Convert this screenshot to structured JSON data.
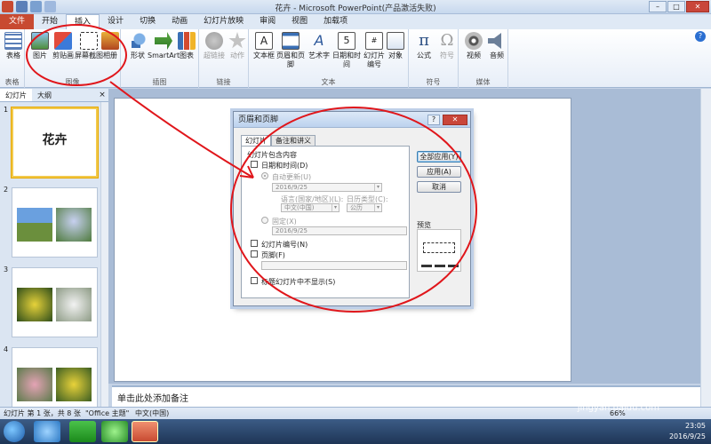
{
  "window": {
    "title": "花卉 - Microsoft PowerPoint(产品激活失败)"
  },
  "tabs": [
    "文件",
    "开始",
    "插入",
    "设计",
    "切换",
    "动画",
    "幻灯片放映",
    "审阅",
    "视图",
    "加载项"
  ],
  "ribbon": {
    "groups": {
      "table": {
        "label": "表格",
        "buttons": [
          "表格"
        ]
      },
      "images": {
        "label": "图像",
        "buttons": [
          "图片",
          "剪贴画",
          "屏幕截图",
          "相册"
        ]
      },
      "illustrations": {
        "label": "插图",
        "buttons": [
          "形状",
          "SmartArt",
          "图表"
        ]
      },
      "links": {
        "label": "链接",
        "buttons": [
          "超链接",
          "动作"
        ]
      },
      "text": {
        "label": "文本",
        "buttons": [
          "文本框",
          "页眉和页脚",
          "艺术字",
          "日期和时间",
          "幻灯片\n编号",
          "对象"
        ]
      },
      "symbols": {
        "label": "符号",
        "buttons": [
          "公式",
          "符号"
        ]
      },
      "media": {
        "label": "媒体",
        "buttons": [
          "视频",
          "音频"
        ]
      }
    }
  },
  "pane": {
    "tabs": [
      "幻灯片",
      "大纲"
    ],
    "close": "×"
  },
  "slides": [
    {
      "num": "1",
      "title": "花卉"
    },
    {
      "num": "2"
    },
    {
      "num": "3"
    },
    {
      "num": "4"
    }
  ],
  "notes_placeholder": "单击此处添加备注",
  "status": {
    "slide_info": "幻灯片 第 1 张，共 8 张",
    "theme": "\"Office 主题\"",
    "language": "中文(中国)",
    "zoom": "66%"
  },
  "clock": {
    "time": "23:05",
    "date": "2016/9/25"
  },
  "dialog": {
    "title": "页眉和页脚",
    "help": "?",
    "close": "✕",
    "tabs": [
      "幻灯片",
      "备注和讲义"
    ],
    "include_label": "幻灯片包含内容",
    "datetime_label": "日期和时间(D)",
    "auto_update_label": "自动更新(U)",
    "auto_date_value": "2016/9/25",
    "language_label": "语言(国家/地区)(L):",
    "calendar_label": "日历类型(C):",
    "language_value": "中文(中国)",
    "calendar_value": "公历",
    "fixed_label": "固定(X)",
    "fixed_value": "2016/9/25",
    "slide_number_label": "幻灯片编号(N)",
    "footer_label": "页脚(F)",
    "footer_value": "",
    "hide_on_title_label": "标题幻灯片中不显示(S)",
    "buttons": {
      "apply_all": "全部应用(Y)",
      "apply": "应用(A)",
      "cancel": "取消"
    },
    "preview_label": "预览"
  },
  "watermark": {
    "text": "Baidu 经验",
    "url": "jingyan.baidu.com"
  },
  "colors": {
    "annotation": "#e0161b",
    "file_tab": "#c84a31",
    "accent": "#2b579a"
  }
}
